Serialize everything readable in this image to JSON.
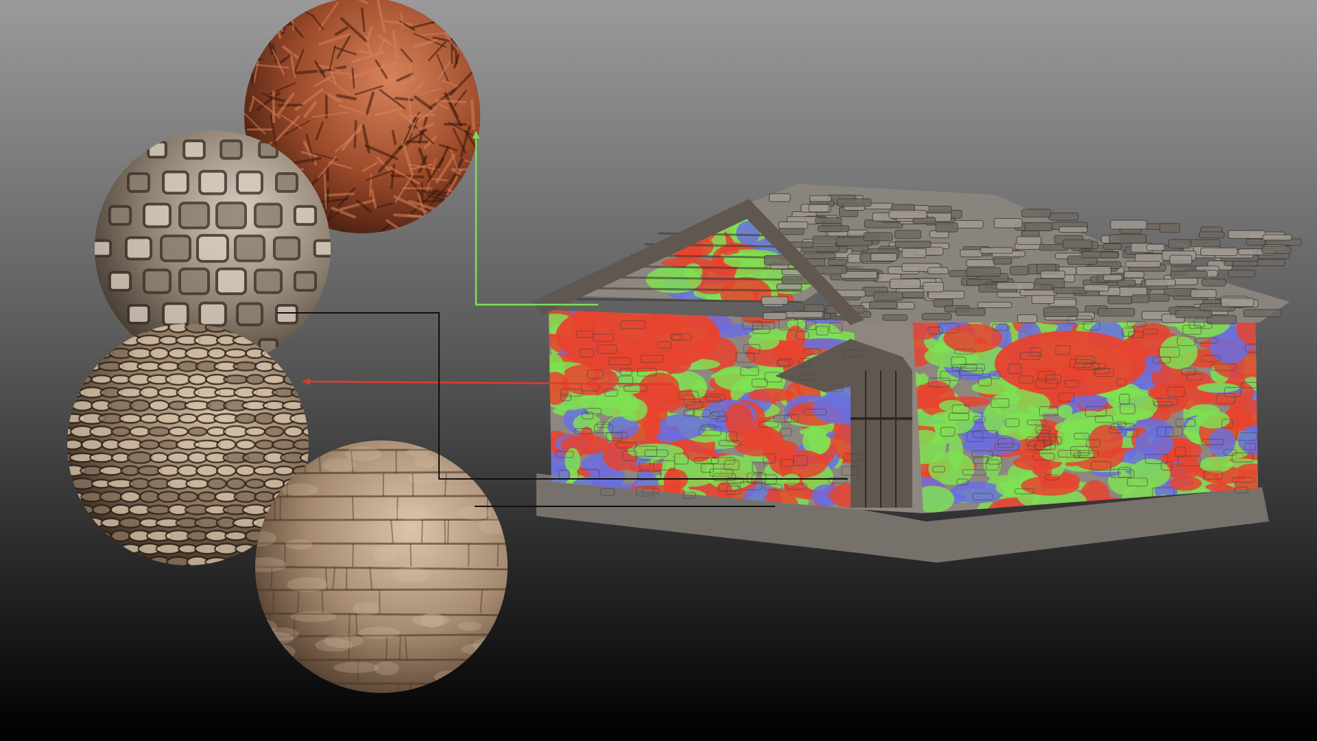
{
  "background": {
    "top_color": "#9a9a9a",
    "mid_color": "#5c5c5c",
    "bottom_color": "#000000"
  },
  "leader_colors": {
    "green": "#7ee05a",
    "red": "#e23a2e",
    "black": "#101010"
  },
  "mask_colors": {
    "red": "#e8432e",
    "green": "#7fe052",
    "blue": "#6a6fe0"
  },
  "materials": [
    {
      "id": "twig-bark",
      "base": "#9b4a2a",
      "dark": "#3a170c",
      "light": "#d8825a",
      "mask": "green"
    },
    {
      "id": "stone-tiles",
      "base": "#8d7f70",
      "dark": "#3b3128",
      "light": "#d8cdbf",
      "mask": "black"
    },
    {
      "id": "stacked-stone",
      "base": "#8a7560",
      "dark": "#2c2118",
      "light": "#d5c2a8",
      "mask": "red"
    },
    {
      "id": "rough-plaster-stone",
      "base": "#a58a70",
      "dark": "#4a3626",
      "light": "#dcc5ab",
      "mask": "black"
    }
  ],
  "house": {
    "wall_color": "#8d8780",
    "roof_color": "#8a847e",
    "wood_color": "#5f5750",
    "foundation_color": "#77716c"
  }
}
